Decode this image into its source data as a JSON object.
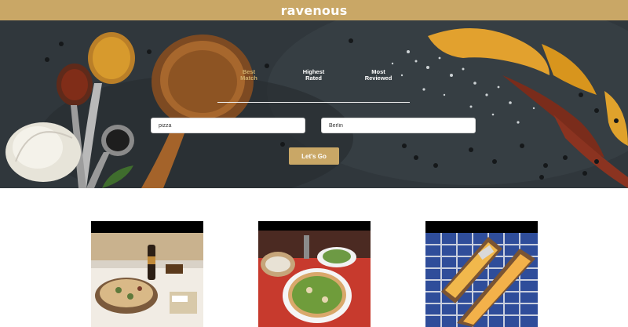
{
  "header": {
    "brand": "ravenous"
  },
  "search": {
    "sort_options": [
      {
        "line1": "Best",
        "line2": "Match",
        "active": true
      },
      {
        "line1": "Highest",
        "line2": "Rated",
        "active": false
      },
      {
        "line1": "Most",
        "line2": "Reviewed",
        "active": false
      }
    ],
    "term_value": "pizza",
    "location_value": "Berlin",
    "submit_label": "Let's Go"
  },
  "colors": {
    "brand_gold": "#c9a766",
    "active_tab": "#cfae6b",
    "hero_background": "#2e3439"
  },
  "results": [
    {
      "image_icon": "pizza-table-photo"
    },
    {
      "image_icon": "pizza-arugula-photo"
    },
    {
      "image_icon": "flatbread-pizza-photo"
    }
  ]
}
